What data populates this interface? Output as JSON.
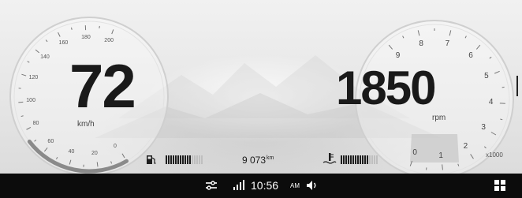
{
  "speedometer": {
    "value": "72",
    "unit": "km/h",
    "scale": [
      "0",
      "20",
      "40",
      "60",
      "80",
      "100",
      "120",
      "140",
      "160",
      "180",
      "200"
    ]
  },
  "tachometer": {
    "value": "1850",
    "unit": "rpm",
    "multiplier": "x1000",
    "scale": [
      "0",
      "1",
      "2",
      "3",
      "4",
      "5",
      "6",
      "7",
      "8",
      "9"
    ]
  },
  "fuel": {
    "level_fraction": 0.7,
    "icon": "fuel-pump-icon"
  },
  "coolant_temp": {
    "level_fraction": 0.75,
    "icon": "thermometer-icon"
  },
  "odometer": {
    "value": "9 073",
    "unit": "km"
  },
  "status_bar": {
    "time": "10:56",
    "ampm": "AM",
    "icons": [
      "settings-sliders-icon",
      "signal-bars-icon",
      "volume-icon",
      "apps-grid-icon"
    ]
  },
  "colors": {
    "accent_arc": "#8a8a8a",
    "status_bar_bg": "#0c0c0c",
    "text": "#1a1a1a"
  }
}
